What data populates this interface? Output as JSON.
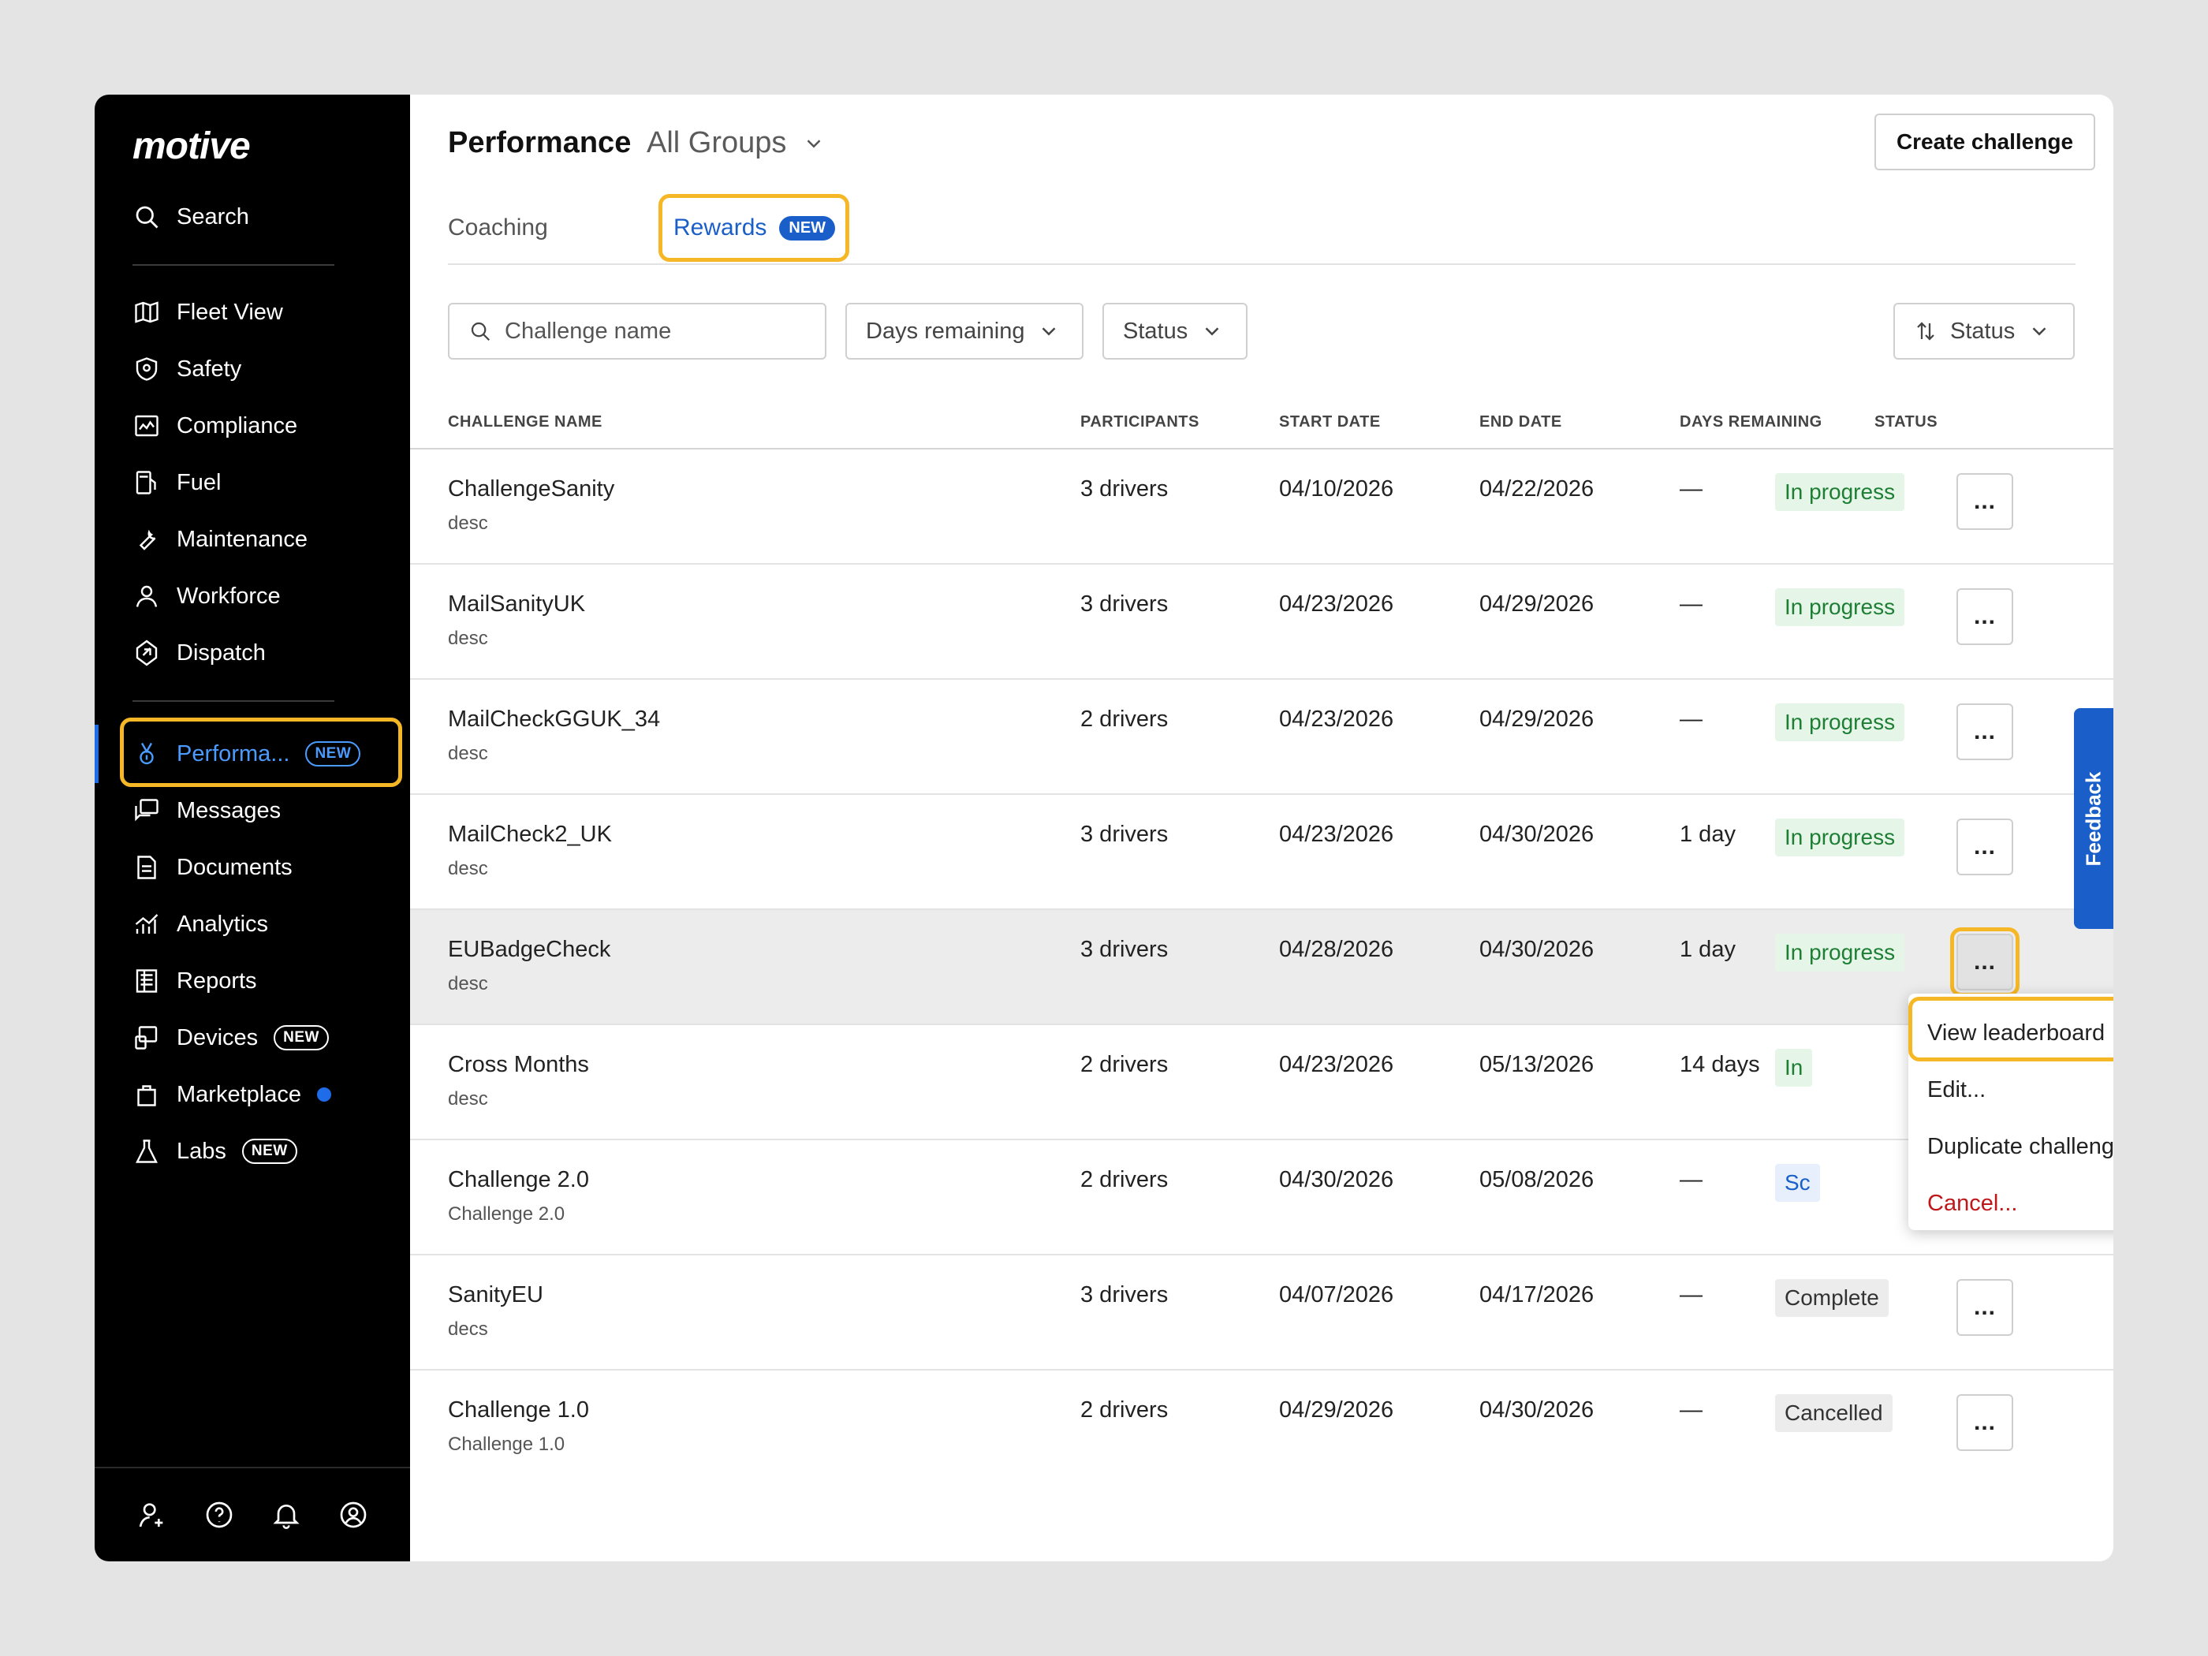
{
  "brand": {
    "logo": "motive"
  },
  "sidebar": {
    "search": "Search",
    "items": [
      {
        "label": "Fleet View",
        "icon": "map-icon"
      },
      {
        "label": "Safety",
        "icon": "shield-icon"
      },
      {
        "label": "Compliance",
        "icon": "compliance-icon"
      },
      {
        "label": "Fuel",
        "icon": "fuel-icon"
      },
      {
        "label": "Maintenance",
        "icon": "wrench-icon"
      },
      {
        "label": "Workforce",
        "icon": "person-icon"
      },
      {
        "label": "Dispatch",
        "icon": "dispatch-icon"
      }
    ],
    "items2": [
      {
        "label": "Performa...",
        "badge": "NEW",
        "icon": "medal-icon",
        "active": true
      },
      {
        "label": "Messages",
        "icon": "messages-icon"
      },
      {
        "label": "Documents",
        "icon": "document-icon"
      },
      {
        "label": "Analytics",
        "icon": "analytics-icon"
      },
      {
        "label": "Reports",
        "icon": "reports-icon"
      },
      {
        "label": "Devices",
        "badge": "NEW",
        "icon": "devices-icon"
      },
      {
        "label": "Marketplace",
        "icon": "bag-icon",
        "dot": true
      },
      {
        "label": "Labs",
        "badge": "NEW",
        "icon": "flask-icon"
      }
    ]
  },
  "header": {
    "title": "Performance",
    "group": "All Groups",
    "create_button": "Create challenge"
  },
  "tabs": [
    {
      "label": "Coaching"
    },
    {
      "label": "Rewards",
      "badge": "NEW",
      "active": true
    }
  ],
  "filters": {
    "search_placeholder": "Challenge name",
    "days_remaining": "Days remaining",
    "status": "Status",
    "sort": "Status"
  },
  "table": {
    "columns": [
      "CHALLENGE NAME",
      "PARTICIPANTS",
      "START DATE",
      "END DATE",
      "DAYS REMAINING",
      "STATUS"
    ],
    "rows": [
      {
        "name": "ChallengeSanity",
        "desc": "desc",
        "participants": "3 drivers",
        "start": "04/10/2026",
        "end": "04/22/2026",
        "days": "—",
        "status": "In progress"
      },
      {
        "name": "MailSanityUK",
        "desc": "desc",
        "participants": "3 drivers",
        "start": "04/23/2026",
        "end": "04/29/2026",
        "days": "—",
        "status": "In progress"
      },
      {
        "name": "MailCheckGGUK_34",
        "desc": "desc",
        "participants": "2 drivers",
        "start": "04/23/2026",
        "end": "04/29/2026",
        "days": "—",
        "status": "In progress"
      },
      {
        "name": "MailCheck2_UK",
        "desc": "desc",
        "participants": "3 drivers",
        "start": "04/23/2026",
        "end": "04/30/2026",
        "days": "1 day",
        "status": "In progress"
      },
      {
        "name": "EUBadgeCheck",
        "desc": "desc",
        "participants": "3 drivers",
        "start": "04/28/2026",
        "end": "04/30/2026",
        "days": "1 day",
        "status": "In progress"
      },
      {
        "name": "Cross Months",
        "desc": "desc",
        "participants": "2 drivers",
        "start": "04/23/2026",
        "end": "05/13/2026",
        "days": "14 days",
        "status": "In"
      },
      {
        "name": "Challenge 2.0",
        "desc": "Challenge 2.0",
        "participants": "2 drivers",
        "start": "04/30/2026",
        "end": "05/08/2026",
        "days": "—",
        "status": "Sc"
      },
      {
        "name": "SanityEU",
        "desc": "decs",
        "participants": "3 drivers",
        "start": "04/07/2026",
        "end": "04/17/2026",
        "days": "—",
        "status": "Complete"
      },
      {
        "name": "Challenge 1.0",
        "desc": "Challenge 1.0",
        "participants": "2 drivers",
        "start": "04/29/2026",
        "end": "04/30/2026",
        "days": "—",
        "status": "Cancelled"
      }
    ],
    "more": "..."
  },
  "menu": {
    "items": [
      "View leaderboard",
      "Edit...",
      "Duplicate challenge...",
      "Cancel..."
    ]
  },
  "feedback": "Feedback",
  "colors": {
    "accent": "#1a5fc9",
    "highlight": "#f6b726",
    "success": "#1e7e34",
    "danger": "#c0171a"
  }
}
